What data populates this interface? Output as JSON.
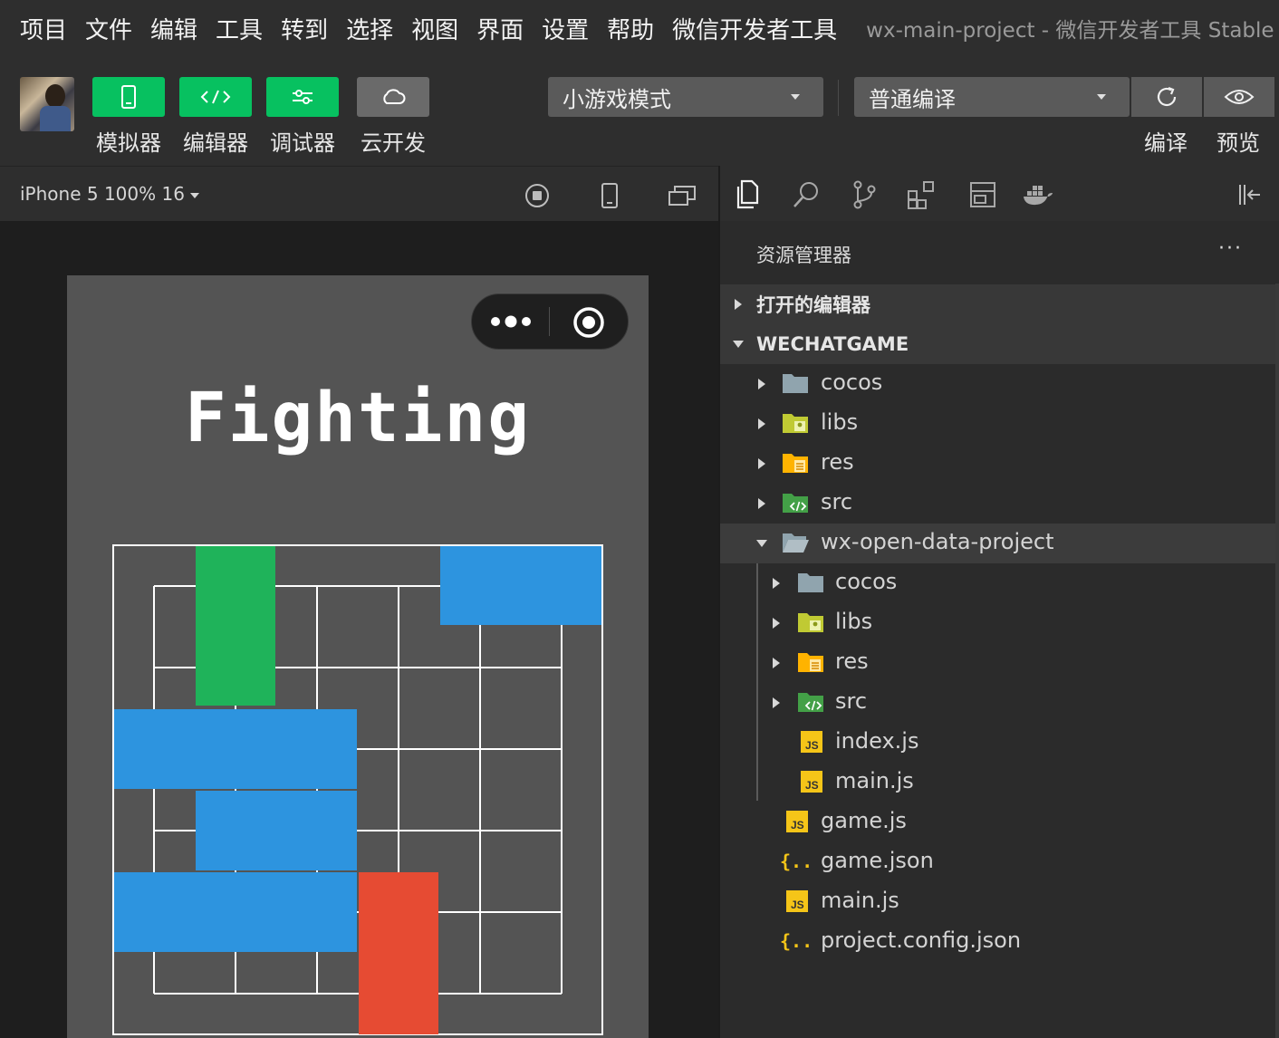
{
  "menu": {
    "items": [
      "项目",
      "文件",
      "编辑",
      "工具",
      "转到",
      "选择",
      "视图",
      "界面",
      "设置",
      "帮助",
      "微信开发者工具"
    ],
    "window_title": "wx-main-project - 微信开发者工具 Stable"
  },
  "toolbar": {
    "simulator_label": "模拟器",
    "editor_label": "编辑器",
    "debugger_label": "调试器",
    "cloud_label": "云开发",
    "mode_select": "小游戏模式",
    "compile_select": "普通编译",
    "compile_label": "编译",
    "preview_label": "预览",
    "accent_color": "#07c160"
  },
  "simulator": {
    "device_info": "iPhone 5 100% 16",
    "game_title": "Fighting",
    "grid_color": "#ffffff",
    "block_colors": {
      "green": "#1fb35a",
      "blue": "#2d94df",
      "red": "#e64b33"
    }
  },
  "explorer": {
    "title": "资源管理器",
    "more": "···",
    "open_editors": "打开的编辑器",
    "root": "WECHATGAME",
    "tree": {
      "cocos": "cocos",
      "libs": "libs",
      "res": "res",
      "src": "src",
      "sub_project": "wx-open-data-project",
      "sub_cocos": "cocos",
      "sub_libs": "libs",
      "sub_res": "res",
      "sub_src": "src",
      "sub_index": "index.js",
      "sub_main": "main.js",
      "game_js": "game.js",
      "game_json": "game.json",
      "main_js": "main.js",
      "project_config": "project.config.json"
    }
  }
}
